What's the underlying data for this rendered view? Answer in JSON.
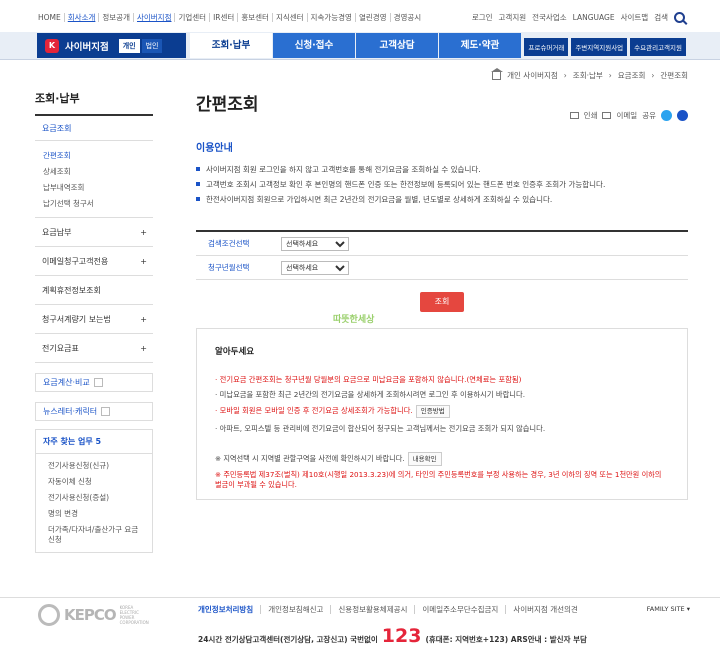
{
  "top": {
    "left": [
      "HOME",
      "회사소개",
      "정보공개",
      "사이버지점",
      "기업센터",
      "IR센터",
      "홍보센터",
      "지식센터",
      "지속가능경영",
      "열린경영",
      "경영공시"
    ],
    "right": [
      "로그인",
      "고객지원",
      "전국사업소",
      "LANGUAGE",
      "사이트맵",
      "검색"
    ]
  },
  "brand": {
    "logo": "K",
    "name": "사이버지점",
    "individual": "개인",
    "corporate": "법인"
  },
  "nav": [
    "조회·납부",
    "신청·접수",
    "고객상담",
    "제도·약관"
  ],
  "quick": [
    "프로슈머거래",
    "주변지역지원사업",
    "수요관리고객지원"
  ],
  "breadcrumb": [
    "개인 사이버지점",
    "조회·납부",
    "요금조회",
    "간편조회"
  ],
  "sidebar": {
    "title": "조회·납부",
    "sub": "요금조회",
    "children": [
      "간편조회",
      "상세조회",
      "납부내역조회",
      "납기선택 청구서"
    ],
    "items": [
      {
        "label": "요금납부",
        "plus": "+"
      },
      {
        "label": "이메일청구고객전용",
        "plus": "+"
      },
      {
        "label": "계획휴전정보조회",
        "plus": ""
      },
      {
        "label": "청구서계량기 보는법",
        "plus": "+"
      },
      {
        "label": "전기요금표",
        "plus": "+"
      }
    ],
    "box1": "요금계산·비교",
    "box2": "뉴스레터·캐릭터",
    "fav_title": "자주 찾는 업무 5",
    "favs": [
      "전기사용신청(신규)",
      "자동이체 신청",
      "전기사용신청(증설)",
      "명의 변경",
      "더가족/다자녀/출산가구 요금 신청"
    ]
  },
  "content": {
    "title": "간편조회",
    "share": [
      "인쇄",
      "이메일",
      "공유"
    ],
    "section": "이용안내",
    "info": [
      "사이버지점 회원 로그인을 하지 않고 고객번호를 통해 전기요금을 조회하실 수 있습니다.",
      "고객번호 조회시 고객정보 확인 후 본인명의 핸드폰 인증 또는 한전정보에 등록되어 있는 핸드폰 번호 인증후 조회가 가능합니다.",
      "한전사이버지점 회원으로 가입하시면 최근 2년간의 전기요금을 월별, 년도별로 상세하게 조회하실 수 있습니다."
    ],
    "form": [
      {
        "label": "검색조건선택",
        "value": "선택하세요"
      },
      {
        "label": "청구년월선택",
        "value": "선택하세요"
      }
    ],
    "search_btn": "조회",
    "stamp": "따뜻한세상"
  },
  "notice": {
    "title": "알아두세요",
    "lines": [
      "전기요금 간편조회는 청구년월 당월분의 요금으로 미납요금을 포함하지 않습니다.(연체료는 포함됨)",
      "미납요금을 포함한 최근 2년간의 전기요금을 상세하게 조회하시려면 로그인 후 이용하시기 바랍니다.",
      "모바일 회원은 모바일 인증 후 전기요금 상세조회가 가능합니다.",
      "아파트, 오피스텔 등 관리비에 전기요금이 합산되어 청구되는 고객님께서는 전기요금 조회가 되지 않습니다."
    ],
    "auth_btn": "인증방법",
    "note1": "지역선택 시 지역별 관할구역을 사전에 확인하시기 바랍니다.",
    "note1_btn": "내용확인",
    "note2": "주민등록법 제37조(벌칙) 제10호(시행일 2013.3.23)에 의거, 타인의 주민등록번호를 부정 사용하는 경우, 3년 이하의 징역 또는 1천만원 이하의 벌금이 부과될 수 있습니다."
  },
  "footer": {
    "logo": "KEPCO",
    "logo_small": "KOREA ELECTRIC POWER CORPORATION",
    "links": [
      "개인정보처리방침",
      "개인정보침해신고",
      "신용정보활용체제공시",
      "이메일주소무단수집금지",
      "사이버지점 개선의견"
    ],
    "family": "FAMILY SITE",
    "call_pre": "24시간 전기상담고객센터(전기상담, 고장신고) 국번없이",
    "call_num": "123",
    "call_post": "(휴대폰: 지역번호+123) ARS안내 : 발신자 부담"
  }
}
